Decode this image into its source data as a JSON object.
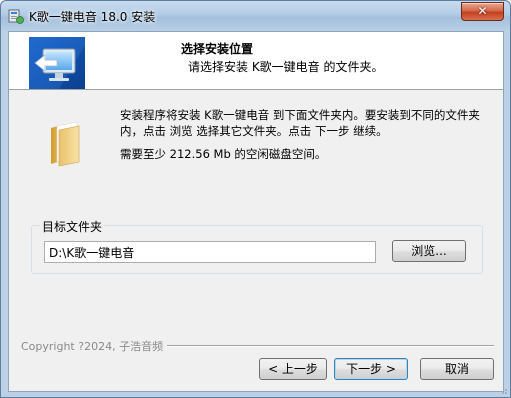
{
  "window": {
    "title": "K歌一键电音 18.0 安装",
    "close_label": "✕"
  },
  "header": {
    "title": "选择安装位置",
    "subtitle": "请选择安装 K歌一键电音 的文件夹。"
  },
  "info": {
    "line1": "安装程序将安装 K歌一键电音 到下面文件夹内。要安装到不同的文件夹内，点击 浏览 选择其它文件夹。点击 下一步 继续。",
    "line2": "需要至少 212.56 Mb 的空闲磁盘空间。"
  },
  "target": {
    "group_label": "目标文件夹",
    "path_value": "D:\\K歌一键电音",
    "browse_label": "浏览..."
  },
  "footer": {
    "copyright": "Copyright ?2024, 子浩音频",
    "back_label": "< 上一步",
    "next_label": "下一步 >",
    "cancel_label": "取消"
  },
  "icons": {
    "app": "installer-icon",
    "header": "monitor-arrow-icon",
    "folder": "folder-icon"
  }
}
